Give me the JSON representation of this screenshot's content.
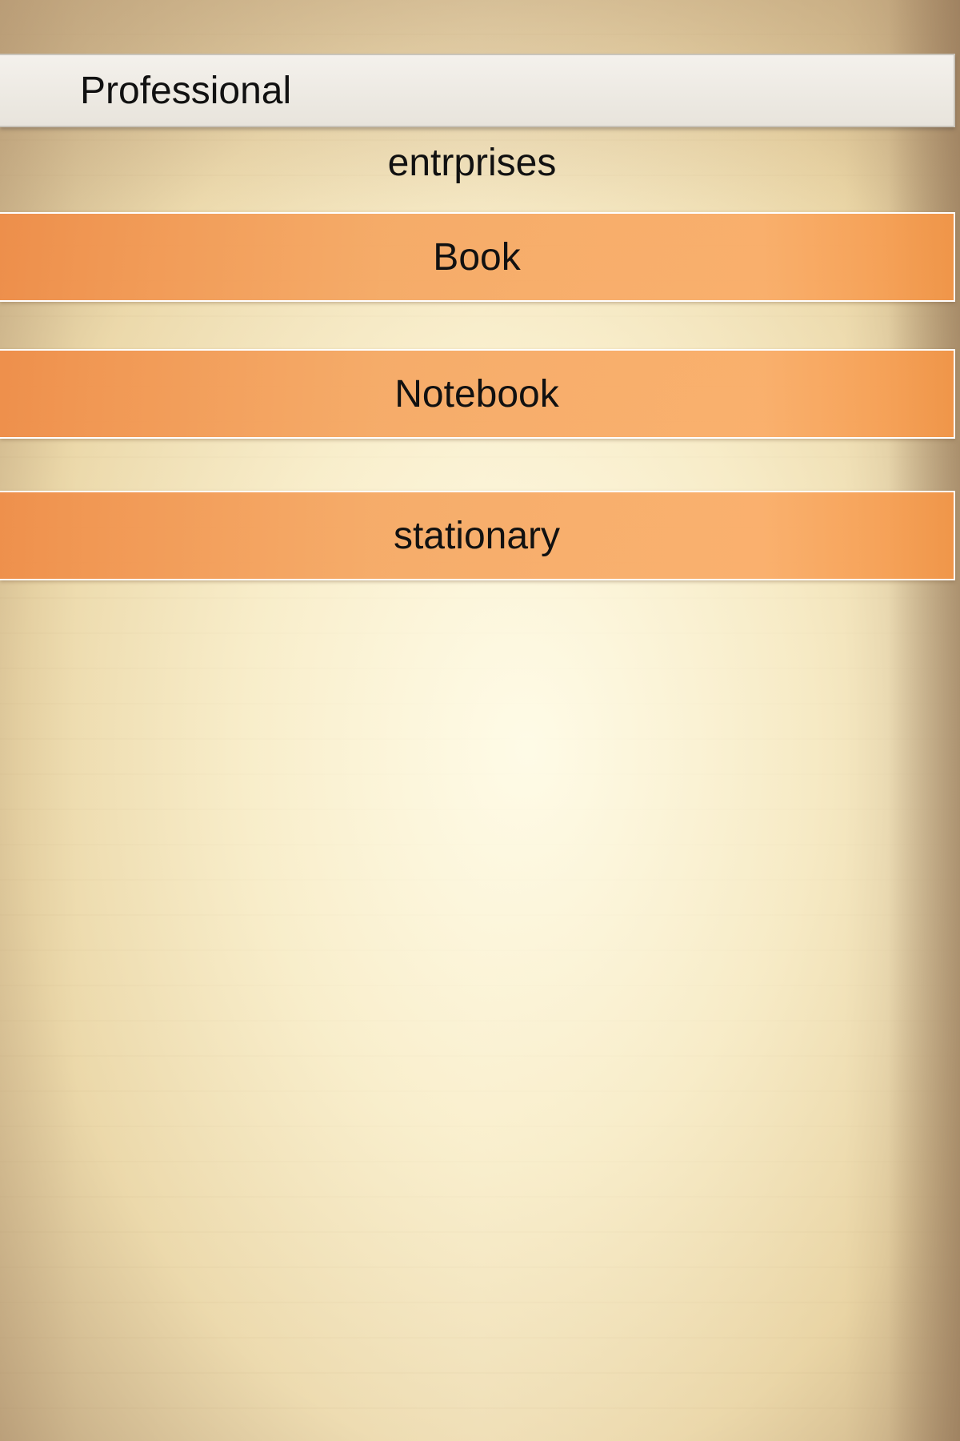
{
  "header": {
    "title": "Professional",
    "subtitle": "entrprises"
  },
  "menu": {
    "items": [
      {
        "label": "Book"
      },
      {
        "label": "Notebook"
      },
      {
        "label": "stationary"
      }
    ]
  },
  "colors": {
    "menu_accent": "#f39a55",
    "header_background": "#efebe4",
    "paper_background": "#f3e4b9"
  }
}
